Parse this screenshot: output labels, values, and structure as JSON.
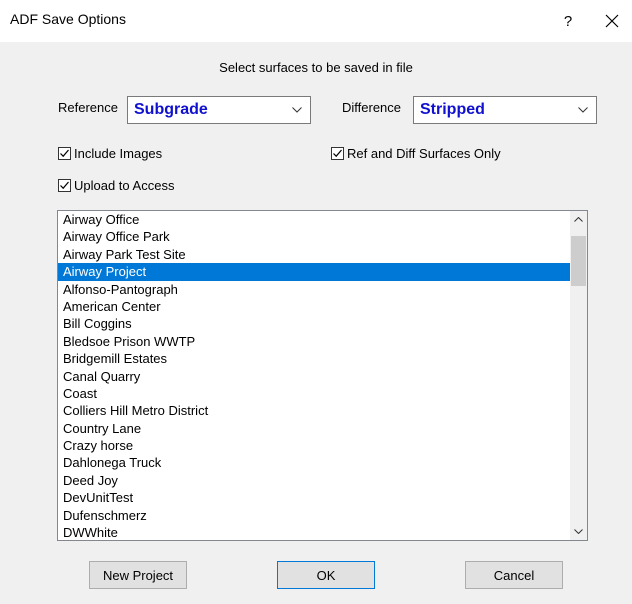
{
  "window": {
    "title": "ADF Save Options",
    "help_label": "?"
  },
  "instruction": "Select surfaces to be saved in file",
  "reference": {
    "label": "Reference",
    "value": "Subgrade"
  },
  "difference": {
    "label": "Difference",
    "value": "Stripped"
  },
  "options": {
    "include_images": {
      "label": "Include Images",
      "checked": true
    },
    "ref_diff_only": {
      "label": "Ref and Diff Surfaces Only",
      "checked": true
    },
    "upload_access": {
      "label": "Upload to Access",
      "checked": true
    }
  },
  "surfaces": {
    "selected": "Airway Project",
    "items": [
      "Airway Office",
      "Airway Office Park",
      "Airway Park Test Site",
      "Airway Project",
      "Alfonso-Pantograph",
      "American Center",
      "Bill Coggins",
      "Bledsoe Prison WWTP",
      "Bridgemill Estates",
      "Canal Quarry",
      "Coast",
      "Colliers Hill Metro District",
      "Country Lane",
      "Crazy horse",
      "Dahlonega Truck",
      "Deed Joy",
      "DevUnitTest",
      "Dufenschmerz",
      "DWWhite"
    ]
  },
  "buttons": {
    "new_project": "New Project",
    "ok": "OK",
    "cancel": "Cancel"
  },
  "colors": {
    "selection": "#0078d7",
    "combo_text": "#1010d0"
  }
}
